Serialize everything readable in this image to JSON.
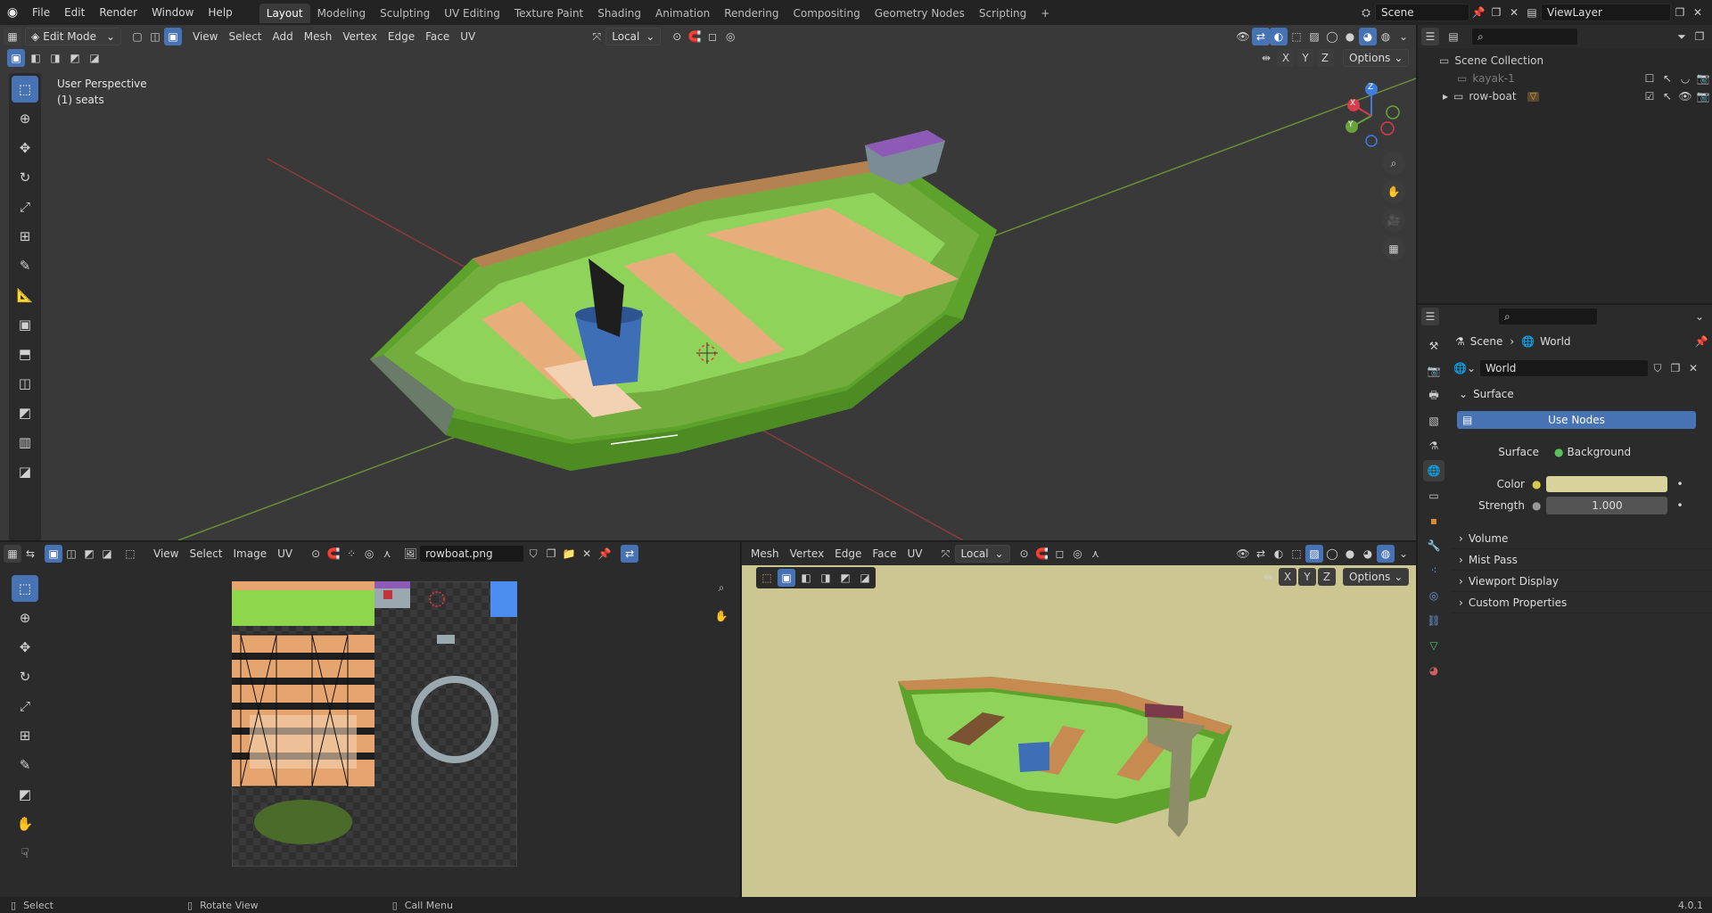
{
  "app": {
    "menus": [
      "File",
      "Edit",
      "Render",
      "Window",
      "Help"
    ],
    "workspaces": [
      "Layout",
      "Modeling",
      "Sculpting",
      "UV Editing",
      "Texture Paint",
      "Shading",
      "Animation",
      "Rendering",
      "Compositing",
      "Geometry Nodes",
      "Scripting"
    ],
    "active_workspace": "Layout",
    "add_tab_label": "+",
    "scene_label": "Scene",
    "viewlayer_label": "ViewLayer"
  },
  "viewport": {
    "mode": "Edit Mode",
    "menus": [
      "View",
      "Select",
      "Add",
      "Mesh",
      "Vertex",
      "Edge",
      "Face",
      "UV"
    ],
    "transform_orientation": "Local",
    "perspective_label": "User Perspective",
    "object_label": "(1) seats",
    "axis_x": "X",
    "axis_y": "Y",
    "axis_z": "Z",
    "options_label": "Options",
    "gizmo": {
      "x": "X",
      "y": "Y",
      "z": "Z"
    }
  },
  "uv_editor": {
    "menus": [
      "View",
      "Select",
      "Image",
      "UV"
    ],
    "image_name": "rowboat.png"
  },
  "viewport2": {
    "menus": [
      "Mesh",
      "Vertex",
      "Edge",
      "Face",
      "UV"
    ],
    "transform_orientation": "Local",
    "axis_x": "X",
    "axis_y": "Y",
    "axis_z": "Z",
    "options_label": "Options"
  },
  "outliner": {
    "root": "Scene Collection",
    "items": [
      {
        "name": "kayak-1"
      },
      {
        "name": "row-boat"
      }
    ]
  },
  "properties": {
    "breadcrumb_scene": "Scene",
    "breadcrumb_world": "World",
    "world_name": "World",
    "surface_section": "Surface",
    "use_nodes_label": "Use Nodes",
    "surface_label": "Surface",
    "surface_value": "Background",
    "color_label": "Color",
    "color_value": "#d8d39a",
    "strength_label": "Strength",
    "strength_value": "1.000",
    "collapsed_sections": [
      "Volume",
      "Mist Pass",
      "Viewport Display",
      "Custom Properties"
    ]
  },
  "statusbar": {
    "select": "Select",
    "rotate": "Rotate View",
    "call_menu": "Call Menu",
    "version": "4.0.1"
  }
}
